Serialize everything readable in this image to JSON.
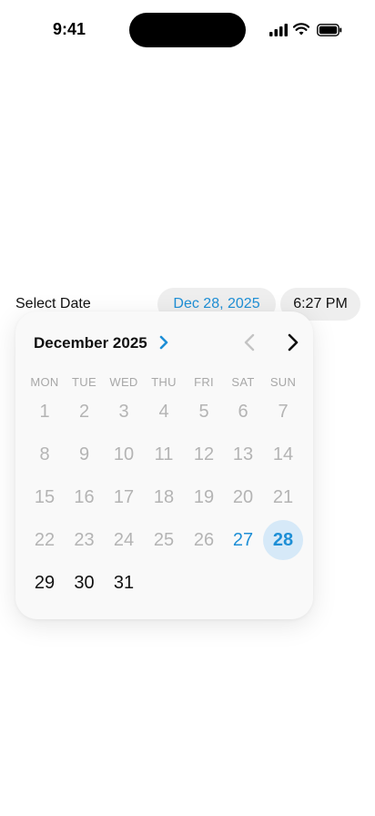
{
  "status_bar": {
    "time": "9:41"
  },
  "picker": {
    "label": "Select Date",
    "date_value": "Dec 28, 2025",
    "time_value": "6:27 PM"
  },
  "calendar": {
    "month_title": "December 2025",
    "weekdays": [
      "MON",
      "TUE",
      "WED",
      "THU",
      "FRI",
      "SAT",
      "SUN"
    ],
    "days": [
      [
        "1",
        "2",
        "3",
        "4",
        "5",
        "6",
        "7"
      ],
      [
        "8",
        "9",
        "10",
        "11",
        "12",
        "13",
        "14"
      ],
      [
        "15",
        "16",
        "17",
        "18",
        "19",
        "20",
        "21"
      ],
      [
        "22",
        "23",
        "24",
        "25",
        "26",
        "27",
        "28"
      ],
      [
        "29",
        "30",
        "31"
      ]
    ],
    "today": "27",
    "selected": "28"
  },
  "colors": {
    "accent": "#1e8fd6",
    "selected_bg": "#d6e9f8",
    "chip_bg": "#eeeeee",
    "disabled_text": "#b4b4b4"
  }
}
